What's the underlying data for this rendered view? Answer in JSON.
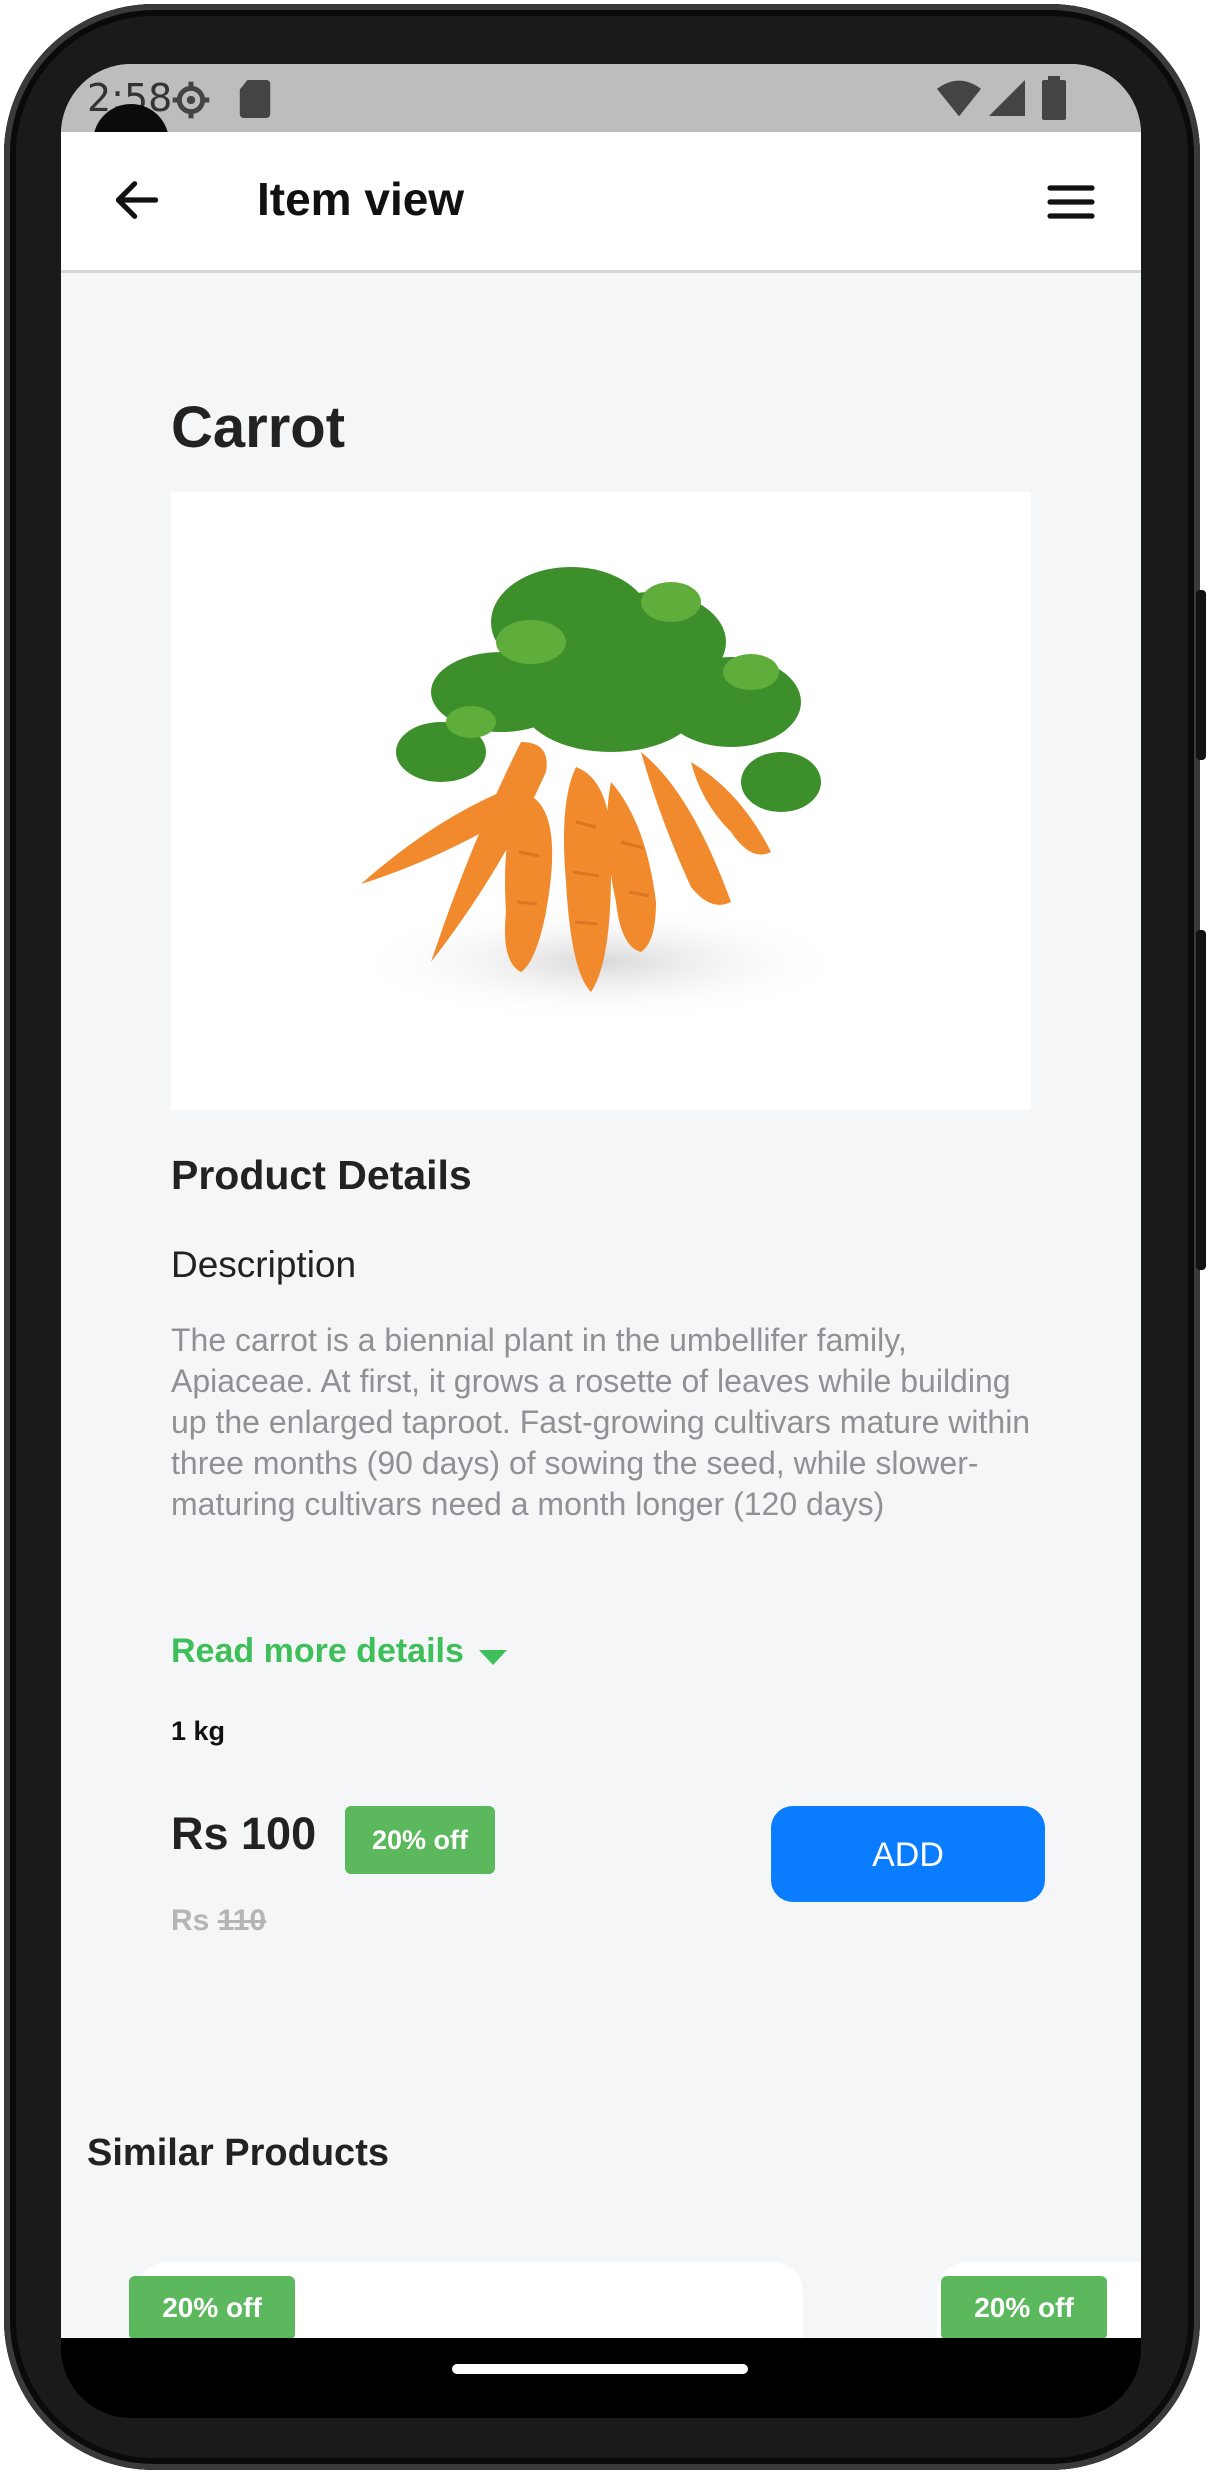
{
  "status_bar": {
    "time": "2:58",
    "icons": [
      "settings-icon",
      "sd-card-icon",
      "wifi-icon",
      "cell-signal-icon",
      "battery-icon"
    ]
  },
  "app_bar": {
    "title": "Item view",
    "back_icon": "arrow-left-icon",
    "menu_icon": "hamburger-menu-icon"
  },
  "product": {
    "name": "Carrot",
    "image": "carrot-bunch-image",
    "section_title": "Product Details",
    "description_heading": "Description",
    "description": "The carrot is a biennial plant in the umbellifer family, Apiaceae. At first, it grows a rosette of leaves while building up the enlarged taproot. Fast-growing cultivars mature within three months (90 days) of sowing the seed, while slower-maturing cultivars need a month longer (120 days)",
    "read_more_label": "Read more details",
    "weight": "1 kg",
    "price": "Rs 100",
    "discount": "20% off",
    "old_price_prefix": "Rs",
    "old_price_value": "110",
    "add_label": "ADD"
  },
  "similar": {
    "title": "Similar Products",
    "cards": [
      {
        "badge": "20% off"
      },
      {
        "badge": "20% off"
      }
    ]
  },
  "colors": {
    "accent_green": "#3fbf5a",
    "badge_green": "#5cb85c",
    "add_blue": "#0a7cff",
    "background": "#f5f6f8"
  }
}
